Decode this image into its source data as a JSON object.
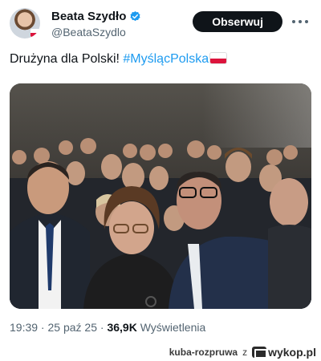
{
  "author": {
    "display_name": "Beata Szydło",
    "handle": "@BeataSzydlo",
    "verified": true,
    "avatar_icon": "profile-avatar",
    "verified_icon": "verified-badge-icon"
  },
  "actions": {
    "follow_label": "Obserwuj",
    "more_icon": "more-options-icon"
  },
  "tweet": {
    "text_plain": "Drużyna dla Polski! ",
    "hashtag": "#MyślącPolska",
    "emoji_icon": "poland-flag-emoji"
  },
  "media": {
    "icon": "group-selfie-photo"
  },
  "meta": {
    "time": "19:39",
    "sep1": " · ",
    "date": "25 paź 25",
    "sep2": " · ",
    "views_count": "36,9K",
    "views_label": " Wyświetlenia"
  },
  "watermark": {
    "user": "kuba-rozpruwa",
    "connector": "z",
    "site": "wykop.pl"
  },
  "colors": {
    "link": "#1d9bf0",
    "text": "#0f1419",
    "muted": "#536471",
    "button_bg": "#0f1419",
    "verified": "#1d9bf0"
  }
}
